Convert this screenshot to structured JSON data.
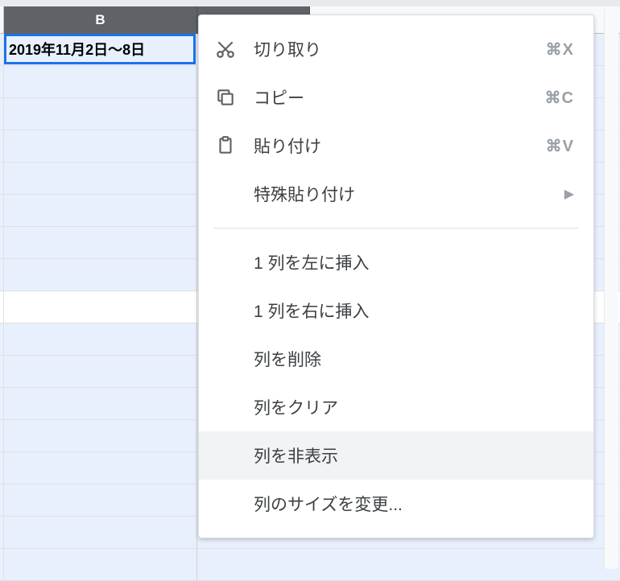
{
  "columns": {
    "b_label": "B"
  },
  "cells": {
    "b1": "2019年11月2日〜8日"
  },
  "menu": {
    "cut": {
      "label": "切り取り",
      "shortcut": "⌘X"
    },
    "copy": {
      "label": "コピー",
      "shortcut": "⌘C"
    },
    "paste": {
      "label": "貼り付け",
      "shortcut": "⌘V"
    },
    "paste_special": {
      "label": "特殊貼り付け"
    },
    "insert_left": {
      "label": "1 列を左に挿入"
    },
    "insert_right": {
      "label": "1 列を右に挿入"
    },
    "delete_col": {
      "label": "列を削除"
    },
    "clear_col": {
      "label": "列をクリア"
    },
    "hide_col": {
      "label": "列を非表示"
    },
    "resize_col": {
      "label": "列のサイズを変更..."
    }
  }
}
